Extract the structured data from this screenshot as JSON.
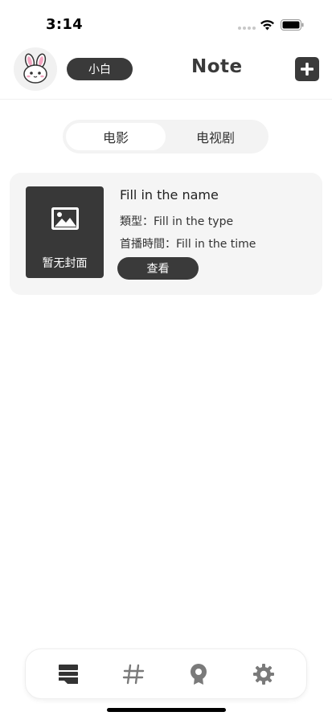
{
  "status_bar": {
    "time": "3:14"
  },
  "header": {
    "user_name": "小白",
    "title": "Note"
  },
  "tabs": [
    {
      "label": "电影",
      "active": true
    },
    {
      "label": "电视剧",
      "active": false
    }
  ],
  "movie_card": {
    "cover_placeholder": "暂无封面",
    "name": "Fill in the name",
    "type_line": "類型：Fill in the type",
    "premiere_line": "首播時間：Fill in the time",
    "view_label": "查看"
  },
  "bottom_nav": {
    "items": [
      {
        "icon": "notes-list-icon",
        "active": true
      },
      {
        "icon": "hashtag-icon",
        "active": false
      },
      {
        "icon": "award-badge-icon",
        "active": false
      },
      {
        "icon": "settings-gear-icon",
        "active": false
      }
    ]
  },
  "colors": {
    "primary_dark": "#3a3a3a",
    "card_bg": "#f5f5f5",
    "segment_bg": "#f3f3f3",
    "nav_icon_inactive": "#7a7a7a"
  }
}
